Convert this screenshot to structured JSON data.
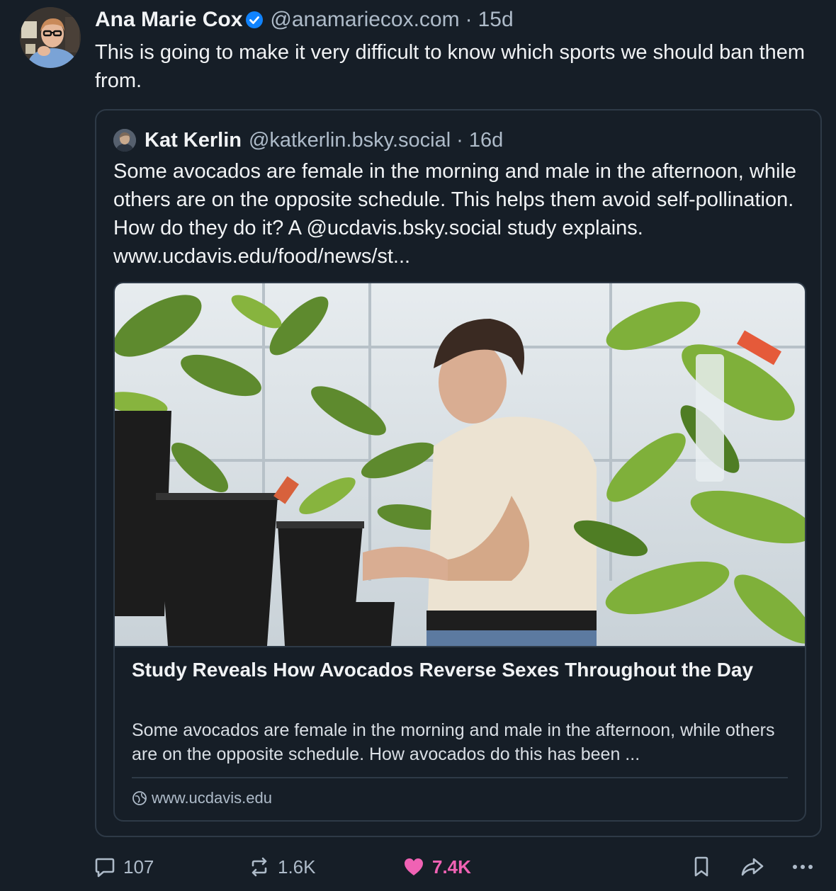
{
  "post": {
    "author": {
      "name": "Ana Marie Cox",
      "handle": "@anamariecox.com",
      "separator": "·",
      "age": "15d",
      "verified": true
    },
    "text": "This is going to make it very difficult to know which sports we should ban them from."
  },
  "quote": {
    "author": {
      "name": "Kat Kerlin",
      "handle": "@katkerlin.bsky.social",
      "separator": "·",
      "age": "16d"
    },
    "text": "Some avocados are female in the morning and male in the afternoon, while others are on the opposite schedule. This helps them avoid self-pollination. How do they do it? A @ucdavis.bsky.social study explains. www.ucdavis.edu/food/news/st...",
    "link_card": {
      "title": "Study Reveals How Avocados Reverse Sexes Throughout the Day",
      "description": "Some avocados are female in the morning and male in the afternoon, while others are on the opposite schedule. How avocados do this has been ...",
      "domain": "www.ucdavis.edu"
    }
  },
  "actions": {
    "replies": "107",
    "reposts": "1.6K",
    "likes": "7.4K",
    "liked": true
  },
  "colors": {
    "background": "#161e27",
    "border": "#2e3a47",
    "muted_text": "#aebbc9",
    "verified_badge": "#1083fe",
    "like_pink": "#f062b4"
  },
  "icons": [
    "verified-check-icon",
    "reply-icon",
    "repost-icon",
    "heart-icon",
    "bookmark-icon",
    "share-icon",
    "more-icon",
    "globe-icon"
  ]
}
